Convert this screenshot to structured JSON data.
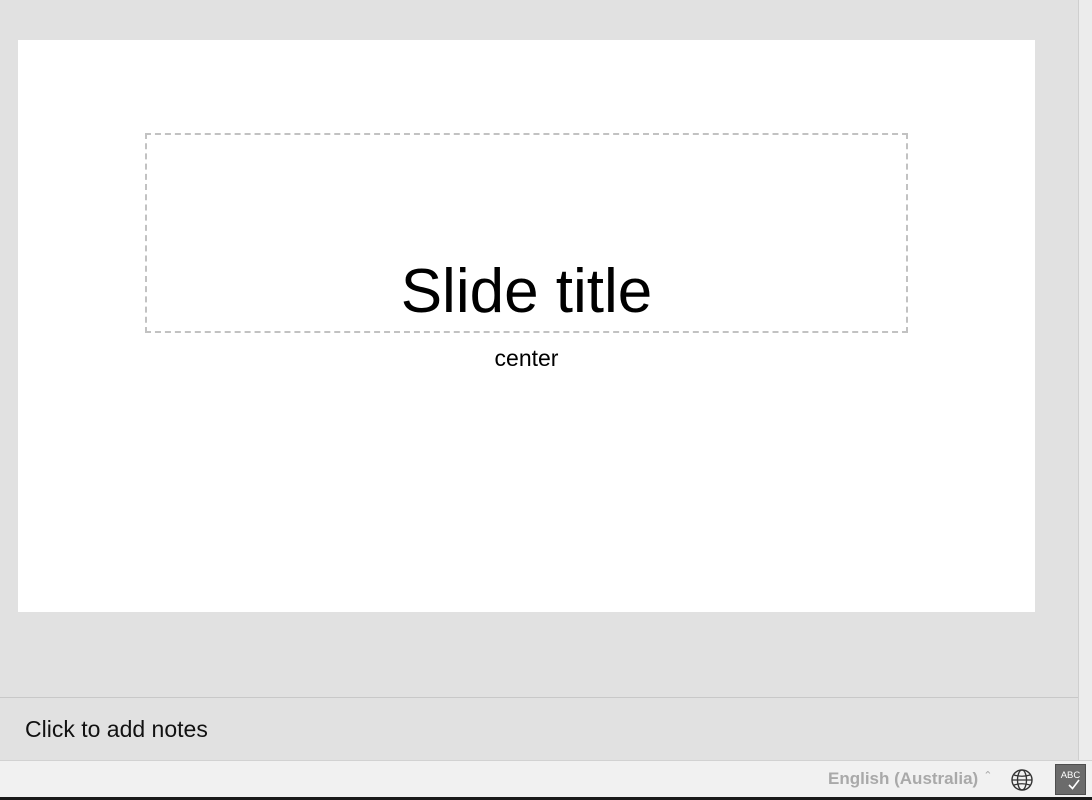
{
  "slide": {
    "title": "Slide title",
    "subtitle": "center"
  },
  "notes": {
    "placeholder": "Click to add notes"
  },
  "status_bar": {
    "language": "English (Australia)",
    "language_caret_icon": "caret-up-icon",
    "globe_icon": "globe-icon",
    "spellcheck_icon": "spellcheck-icon",
    "spellcheck_text": "ABC"
  },
  "colors": {
    "canvas_background": "#e1e1e1",
    "slide_background": "#ffffff",
    "placeholder_border": "#c2c2c2",
    "status_text": "#a9a9a9",
    "spellcheck_active": "#6b6b6b"
  }
}
